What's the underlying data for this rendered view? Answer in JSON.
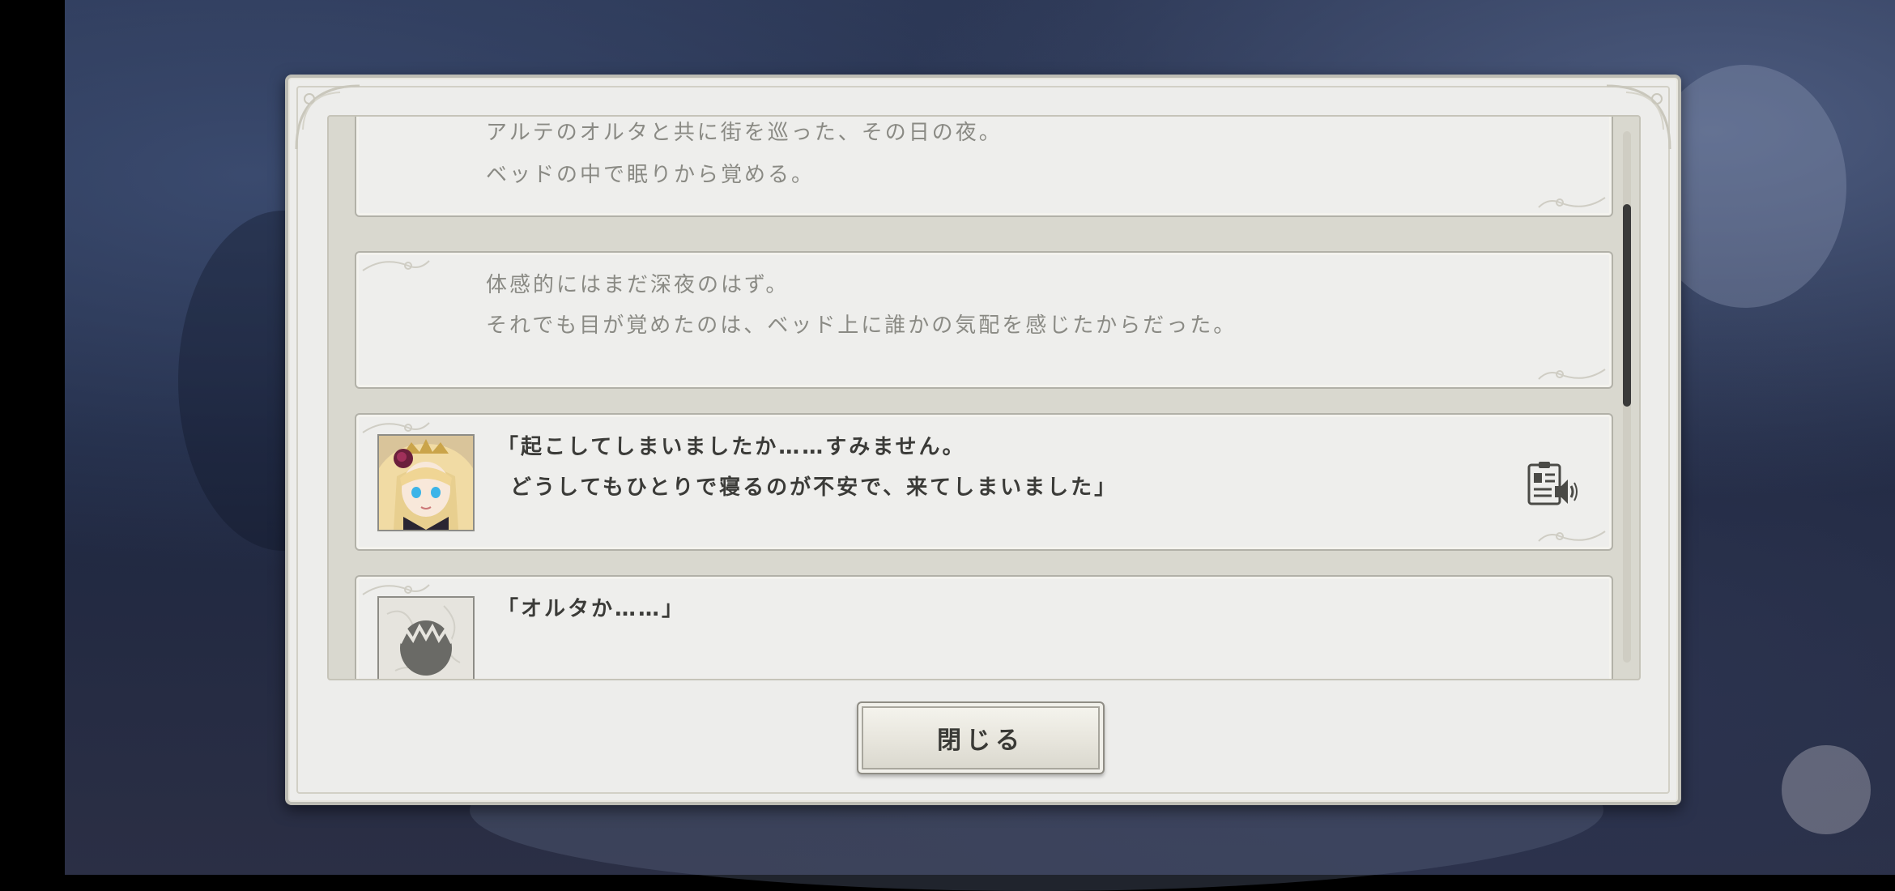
{
  "background": {
    "accent": "#2a3552"
  },
  "dialog": {
    "log_entries": [
      {
        "type": "narration",
        "lines": [
          "アルテのオルタと共に街を巡った、その日の夜。",
          "ベッドの中で眠りから覚める。"
        ]
      },
      {
        "type": "narration",
        "lines": [
          "体感的にはまだ深夜のはず。",
          "それでも目が覚めたのは、ベッド上に誰かの気配を感じたからだった。"
        ]
      },
      {
        "type": "speech",
        "avatar": "blonde-crowned-girl",
        "lines": [
          "「起こしてしまいましたか……すみません。",
          "どうしてもひとりで寝るのが不安で、来てしまいました」"
        ],
        "voice_icon": "voice-playback-icon"
      },
      {
        "type": "speech",
        "avatar": "silhouette-player",
        "lines": [
          "「オルタか……」"
        ]
      }
    ],
    "close_label": "閉じる"
  }
}
